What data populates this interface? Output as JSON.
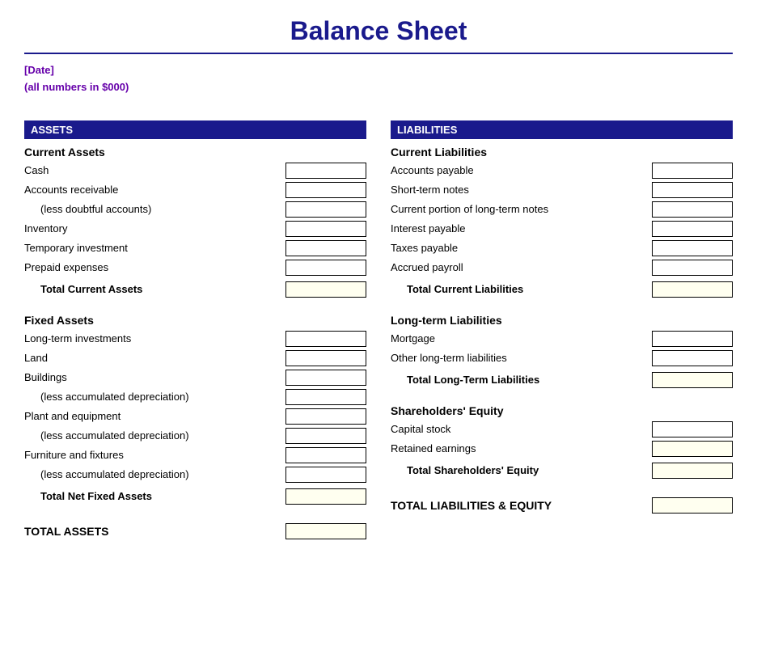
{
  "title": "Balance Sheet",
  "date_line1": "[Date]",
  "date_line2": "(all numbers in $000)",
  "assets_header": "ASSETS",
  "liabilities_header": "LIABILITIES",
  "current_assets": {
    "title": "Current Assets",
    "items": [
      {
        "label": "Cash",
        "indent": false
      },
      {
        "label": "Accounts receivable",
        "indent": false
      },
      {
        "label": "(less doubtful accounts)",
        "indent": true
      },
      {
        "label": "Inventory",
        "indent": false
      },
      {
        "label": "Temporary investment",
        "indent": false
      },
      {
        "label": "Prepaid expenses",
        "indent": false
      }
    ],
    "total_label": "Total Current Assets"
  },
  "fixed_assets": {
    "title": "Fixed Assets",
    "items": [
      {
        "label": "Long-term investments",
        "indent": false
      },
      {
        "label": "Land",
        "indent": false
      },
      {
        "label": "Buildings",
        "indent": false
      },
      {
        "label": "(less accumulated depreciation)",
        "indent": true
      },
      {
        "label": "Plant and equipment",
        "indent": false
      },
      {
        "label": "(less accumulated depreciation)",
        "indent": true
      },
      {
        "label": "Furniture and fixtures",
        "indent": false
      },
      {
        "label": "(less accumulated depreciation)",
        "indent": true
      }
    ],
    "total_label": "Total Net Fixed Assets"
  },
  "total_assets_label": "TOTAL ASSETS",
  "current_liabilities": {
    "title": "Current Liabilities",
    "items": [
      {
        "label": "Accounts payable",
        "indent": false
      },
      {
        "label": "Short-term notes",
        "indent": false
      },
      {
        "label": "Current portion of long-term notes",
        "indent": false
      },
      {
        "label": "Interest payable",
        "indent": false
      },
      {
        "label": "Taxes payable",
        "indent": false
      },
      {
        "label": "Accrued payroll",
        "indent": false
      }
    ],
    "total_label": "Total Current Liabilities"
  },
  "longterm_liabilities": {
    "title": "Long-term Liabilities",
    "items": [
      {
        "label": "Mortgage",
        "indent": false
      },
      {
        "label": "Other long-term liabilities",
        "indent": false
      }
    ],
    "total_label": "Total Long-Term Liabilities"
  },
  "shareholders_equity": {
    "title": "Shareholders' Equity",
    "items": [
      {
        "label": "Capital stock",
        "indent": false
      },
      {
        "label": "Retained earnings",
        "indent": false
      }
    ],
    "total_label": "Total Shareholders' Equity"
  },
  "total_liabilities_label": "TOTAL LIABILITIES & EQUITY"
}
